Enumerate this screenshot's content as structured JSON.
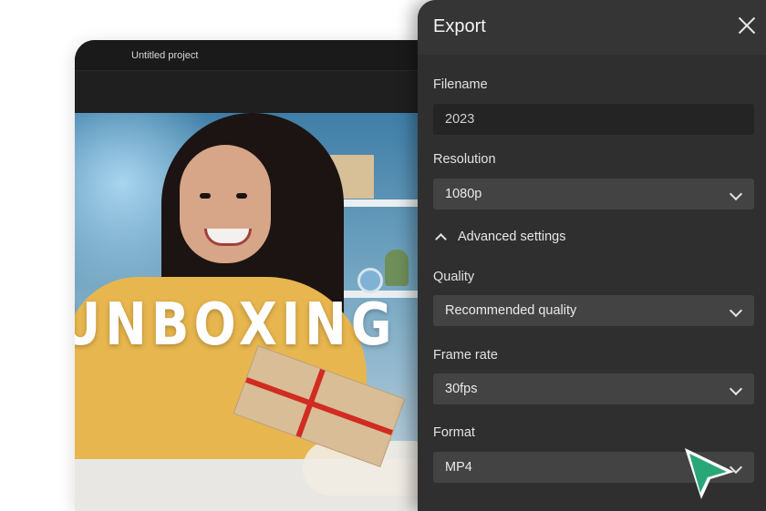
{
  "editor": {
    "title": "Untitled project",
    "canvas_text": "UNBOXING"
  },
  "export_panel": {
    "title": "Export",
    "filename": {
      "label": "Filename",
      "value": "2023"
    },
    "resolution": {
      "label": "Resolution",
      "value": "1080p"
    },
    "advanced": {
      "label": "Advanced settings",
      "expanded": true
    },
    "quality": {
      "label": "Quality",
      "value": "Recommended quality"
    },
    "frame_rate": {
      "label": "Frame rate",
      "value": "30fps"
    },
    "format": {
      "label": "Format",
      "value": "MP4"
    }
  },
  "icons": {
    "close": "close-icon",
    "chevron": "chevron-down-icon",
    "chevron_up": "chevron-up-icon",
    "cursor": "pointer-cursor-icon"
  },
  "colors": {
    "panel_bg": "#2f2f2f",
    "select_bg": "#434343",
    "input_bg": "#242424",
    "cursor_green": "#2aa779"
  }
}
